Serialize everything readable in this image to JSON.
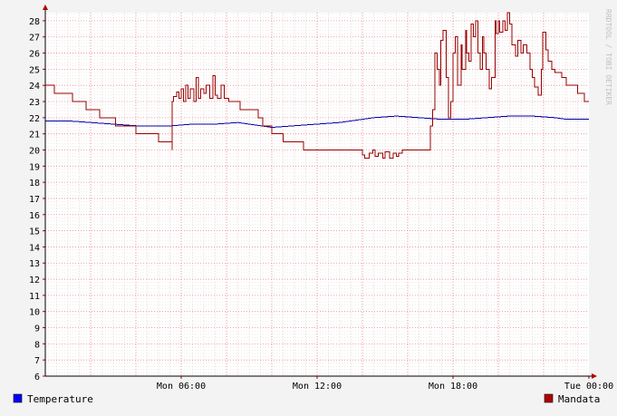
{
  "chart_data": {
    "type": "line",
    "title": "",
    "xlabel": "",
    "ylabel": "",
    "ylim": [
      6,
      28.5
    ],
    "y_ticks": [
      6,
      7,
      8,
      9,
      10,
      11,
      12,
      13,
      14,
      15,
      16,
      17,
      18,
      19,
      20,
      21,
      22,
      23,
      24,
      25,
      26,
      27,
      28
    ],
    "x_range": [
      0,
      24
    ],
    "x_ticks": [
      {
        "x": 6,
        "label": "Mon 06:00"
      },
      {
        "x": 12,
        "label": "Mon 12:00"
      },
      {
        "x": 18,
        "label": "Mon 18:00"
      },
      {
        "x": 24,
        "label": "Tue 00:00"
      }
    ],
    "grid": true,
    "watermark": "RRDTOOL / TOBI OETIKER",
    "legend_position": "bottom",
    "series": [
      {
        "name": "Temperature",
        "color": "#0000aa",
        "legend_color": "#0000ff",
        "step": false,
        "points": [
          [
            0,
            21.8
          ],
          [
            1,
            21.8
          ],
          [
            2,
            21.7
          ],
          [
            3,
            21.6
          ],
          [
            4,
            21.5
          ],
          [
            5,
            21.5
          ],
          [
            5.6,
            21.5
          ],
          [
            6.5,
            21.6
          ],
          [
            7.5,
            21.6
          ],
          [
            8.5,
            21.7
          ],
          [
            9,
            21.6
          ],
          [
            10,
            21.4
          ],
          [
            11,
            21.5
          ],
          [
            12,
            21.6
          ],
          [
            13,
            21.7
          ],
          [
            14,
            21.9
          ],
          [
            14.5,
            22.0
          ],
          [
            15.5,
            22.1
          ],
          [
            16.5,
            22.0
          ],
          [
            17.5,
            21.9
          ],
          [
            18.5,
            21.9
          ],
          [
            19.5,
            22.0
          ],
          [
            20.5,
            22.1
          ],
          [
            21.5,
            22.1
          ],
          [
            22.5,
            22.0
          ],
          [
            23,
            21.9
          ],
          [
            24,
            21.9
          ]
        ]
      },
      {
        "name": "Mandata",
        "color": "#990000",
        "legend_color": "#b00000",
        "step": true,
        "points": [
          [
            0,
            24.0
          ],
          [
            0.4,
            23.5
          ],
          [
            1.2,
            23.0
          ],
          [
            1.8,
            22.5
          ],
          [
            2.4,
            22.0
          ],
          [
            3.1,
            21.5
          ],
          [
            4,
            21.0
          ],
          [
            5,
            20.5
          ],
          [
            5.1,
            20.5
          ],
          [
            5.6,
            20.0
          ],
          [
            5.6,
            23.0
          ],
          [
            5.65,
            23.3
          ],
          [
            5.8,
            23.6
          ],
          [
            5.9,
            23.2
          ],
          [
            6.0,
            23.8
          ],
          [
            6.1,
            23.0
          ],
          [
            6.2,
            24.0
          ],
          [
            6.3,
            23.2
          ],
          [
            6.4,
            23.8
          ],
          [
            6.55,
            23.0
          ],
          [
            6.65,
            24.5
          ],
          [
            6.75,
            23.2
          ],
          [
            6.85,
            23.8
          ],
          [
            7.0,
            23.5
          ],
          [
            7.1,
            24.0
          ],
          [
            7.25,
            23.2
          ],
          [
            7.4,
            24.6
          ],
          [
            7.5,
            23.4
          ],
          [
            7.6,
            23.2
          ],
          [
            7.75,
            24.0
          ],
          [
            7.9,
            23.2
          ],
          [
            8.1,
            23.0
          ],
          [
            8.6,
            22.5
          ],
          [
            9.4,
            22.0
          ],
          [
            9.6,
            21.5
          ],
          [
            10,
            21.0
          ],
          [
            10.5,
            20.5
          ],
          [
            11.4,
            20.0
          ],
          [
            14,
            20.0
          ],
          [
            14,
            19.7
          ],
          [
            14.1,
            19.5
          ],
          [
            14.3,
            19.8
          ],
          [
            14.45,
            20.0
          ],
          [
            14.55,
            19.6
          ],
          [
            14.7,
            19.8
          ],
          [
            14.9,
            19.5
          ],
          [
            15.0,
            19.9
          ],
          [
            15.2,
            19.5
          ],
          [
            15.35,
            19.8
          ],
          [
            15.5,
            19.6
          ],
          [
            15.6,
            19.8
          ],
          [
            15.75,
            20.0
          ],
          [
            15.9,
            20.0
          ],
          [
            16.2,
            20.0
          ],
          [
            16.5,
            20.0
          ],
          [
            16.9,
            20.0
          ],
          [
            17,
            21.5
          ],
          [
            17.1,
            22.5
          ],
          [
            17.2,
            26.0
          ],
          [
            17.3,
            25.0
          ],
          [
            17.4,
            24.0
          ],
          [
            17.45,
            26.8
          ],
          [
            17.55,
            27.4
          ],
          [
            17.7,
            24.5
          ],
          [
            17.8,
            22.0
          ],
          [
            17.9,
            23.0
          ],
          [
            18.0,
            26.0
          ],
          [
            18.1,
            27.0
          ],
          [
            18.2,
            24.0
          ],
          [
            18.35,
            26.5
          ],
          [
            18.4,
            25.0
          ],
          [
            18.55,
            27.4
          ],
          [
            18.6,
            26.0
          ],
          [
            18.7,
            25.5
          ],
          [
            18.8,
            27.8
          ],
          [
            18.9,
            27.0
          ],
          [
            19.0,
            28.0
          ],
          [
            19.1,
            26.0
          ],
          [
            19.2,
            25.0
          ],
          [
            19.3,
            27.0
          ],
          [
            19.35,
            26.0
          ],
          [
            19.45,
            25.0
          ],
          [
            19.6,
            23.8
          ],
          [
            19.7,
            24.5
          ],
          [
            19.85,
            28.0
          ],
          [
            19.9,
            27.2
          ],
          [
            20.0,
            28.0
          ],
          [
            20.05,
            27.3
          ],
          [
            20.2,
            28.0
          ],
          [
            20.3,
            27.4
          ],
          [
            20.4,
            28.5
          ],
          [
            20.5,
            27.8
          ],
          [
            20.6,
            26.5
          ],
          [
            20.75,
            25.8
          ],
          [
            20.85,
            26.8
          ],
          [
            21.0,
            26.0
          ],
          [
            21.1,
            26.5
          ],
          [
            21.25,
            26.0
          ],
          [
            21.4,
            25.0
          ],
          [
            21.5,
            24.5
          ],
          [
            21.6,
            23.9
          ],
          [
            21.75,
            23.4
          ],
          [
            21.9,
            25.0
          ],
          [
            21.95,
            27.3
          ],
          [
            22.1,
            26.2
          ],
          [
            22.2,
            25.5
          ],
          [
            22.35,
            25.0
          ],
          [
            22.5,
            24.8
          ],
          [
            22.8,
            24.5
          ],
          [
            23,
            24.0
          ],
          [
            23.5,
            23.5
          ],
          [
            23.8,
            23.0
          ],
          [
            24,
            23.0
          ]
        ]
      }
    ]
  }
}
